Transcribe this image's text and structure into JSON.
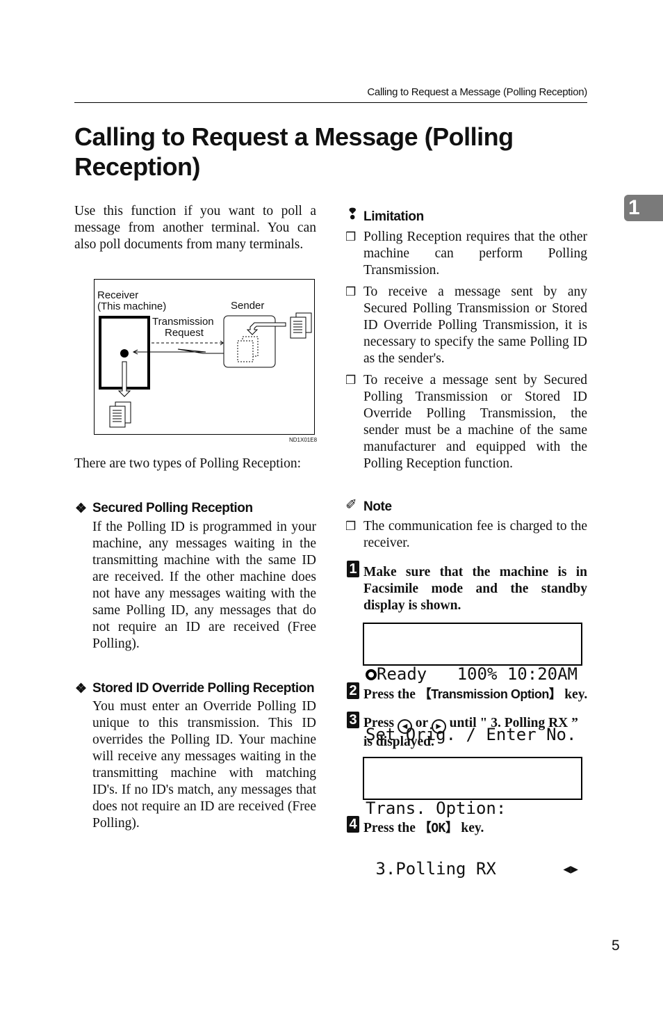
{
  "running_head": "Calling to Request a Message (Polling Reception)",
  "chapter_tab": "1",
  "title": "Calling to Request a Message (Polling Reception)",
  "intro": "Use this function if you want to poll a message from another terminal. You can also poll documents from many terminals.",
  "diagram": {
    "receiver_label_1": "Receiver",
    "receiver_label_2": "(This machine)",
    "sender_label": "Sender",
    "request_label_1": "Transmission",
    "request_label_2": "Request",
    "figure_id": "ND1X01E8"
  },
  "types_intro": "There are two types of Polling Reception:",
  "types": [
    {
      "heading": "Secured Polling Reception",
      "body": "If the Polling ID is programmed in your machine, any messages waiting in the transmitting machine with the same ID are received. If the other machine does not have any messages waiting with the same Polling ID, any messages that do not require an ID are received (Free Polling)."
    },
    {
      "heading": "Stored ID Override Polling Reception",
      "body": "You must enter an Override Polling ID unique to this transmission. This ID overrides the Polling ID. Your machine will receive any messages waiting in the transmitting machine with matching ID's. If no ID's match, any messages that does not require an ID are received (Free Polling)."
    }
  ],
  "limitation": {
    "heading": "Limitation",
    "items": [
      "Polling Reception requires that the other machine can perform Polling Transmission.",
      "To receive a message sent by any Secured Polling Transmission or Stored ID Override Polling Transmission, it is necessary to specify the same Polling ID as the sender's.",
      "To receive a message sent by Secured Polling Transmission or Stored ID Override Polling Transmission, the sender must be a machine of the same manufacturer and equipped with the Polling Reception function."
    ]
  },
  "note": {
    "heading": "Note",
    "items": [
      "The communication fee is charged to the receiver."
    ]
  },
  "steps": [
    {
      "num": "1",
      "text": "Make sure that the machine is in Facsimile mode and the standby display is shown."
    },
    {
      "num": "2",
      "pre": "Press the ",
      "key": "Transmission Option",
      "post": " key."
    },
    {
      "num": "3",
      "pre": "Press ",
      "mid": " or ",
      "post": " until \" 3. Polling RX ” is displayed."
    },
    {
      "num": "4",
      "pre": "Press the ",
      "key": "OK",
      "post": " key."
    }
  ],
  "lcd1": {
    "line1": "Ready   100% 10:20AM",
    "line2": "Set Orig. / Enter No."
  },
  "lcd2": {
    "line1": "Trans. Option:",
    "line2": " 3.Polling RX"
  },
  "page_number": "5"
}
